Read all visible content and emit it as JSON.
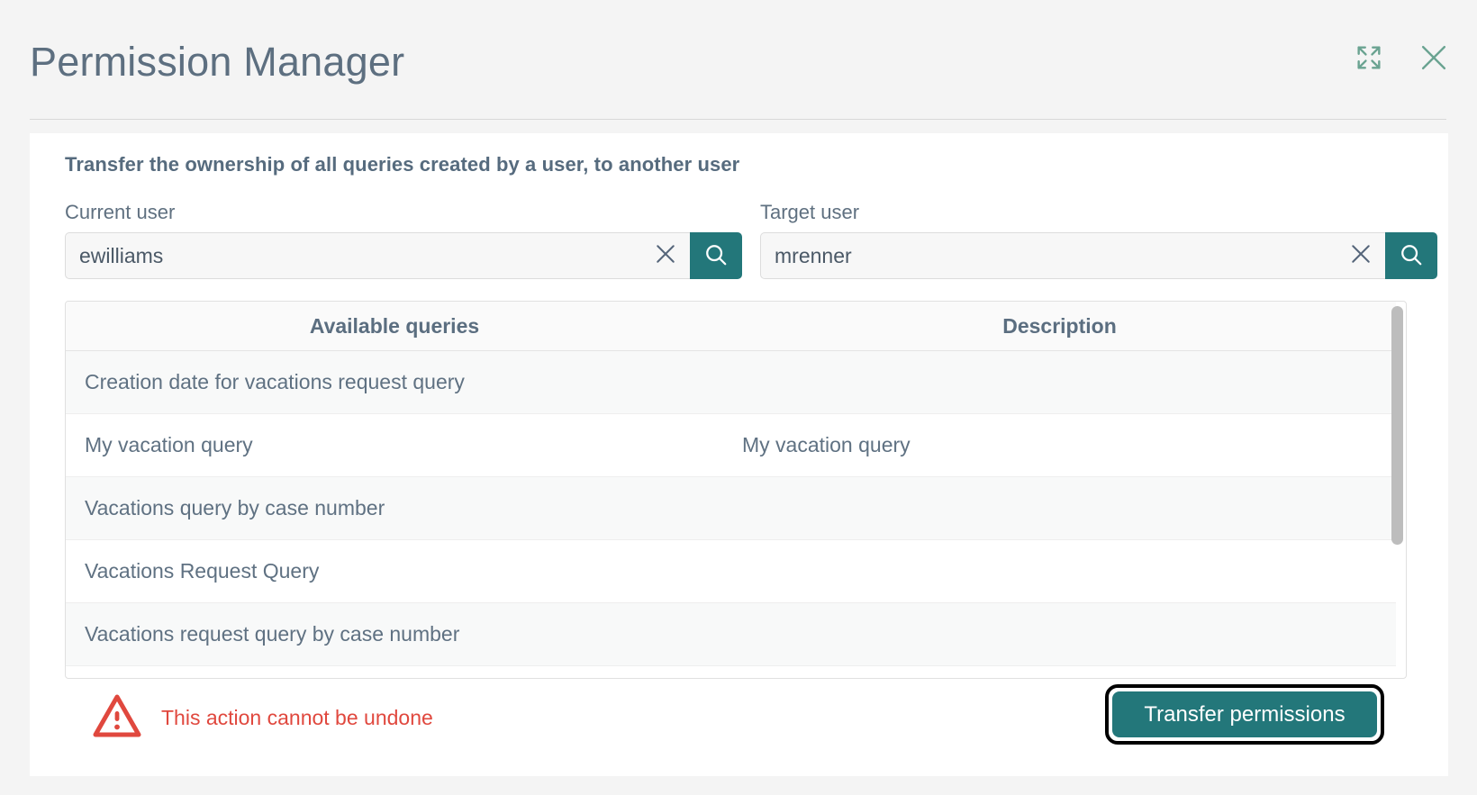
{
  "header": {
    "title": "Permission Manager",
    "expand_icon": "expand-icon",
    "close_icon": "close-icon",
    "accent_color": "#6aa391"
  },
  "card": {
    "intro": "Transfer the ownership of all queries created by a user, to another user"
  },
  "fields": {
    "current_user": {
      "label": "Current user",
      "value": "ewilliams",
      "placeholder": "",
      "clear_icon": "close-icon",
      "search_icon": "search-icon"
    },
    "target_user": {
      "label": "Target user",
      "value": "mrenner",
      "placeholder": "",
      "clear_icon": "close-icon",
      "search_icon": "search-icon"
    }
  },
  "table": {
    "columns": [
      "Available queries",
      "Description"
    ],
    "rows": [
      {
        "query": "Creation date for vacations request query",
        "description": ""
      },
      {
        "query": "My vacation query",
        "description": "My vacation query"
      },
      {
        "query": "Vacations query by case number",
        "description": ""
      },
      {
        "query": "Vacations Request Query",
        "description": ""
      },
      {
        "query": "Vacations request query by case number",
        "description": ""
      }
    ],
    "scrollbar": {
      "visible": true
    }
  },
  "footer": {
    "warning_icon": "warning-triangle-icon",
    "warning_text": "This action cannot be undone",
    "warning_color": "#e0483e",
    "primary_button": "Transfer permissions",
    "primary_button_color": "#23777a"
  }
}
